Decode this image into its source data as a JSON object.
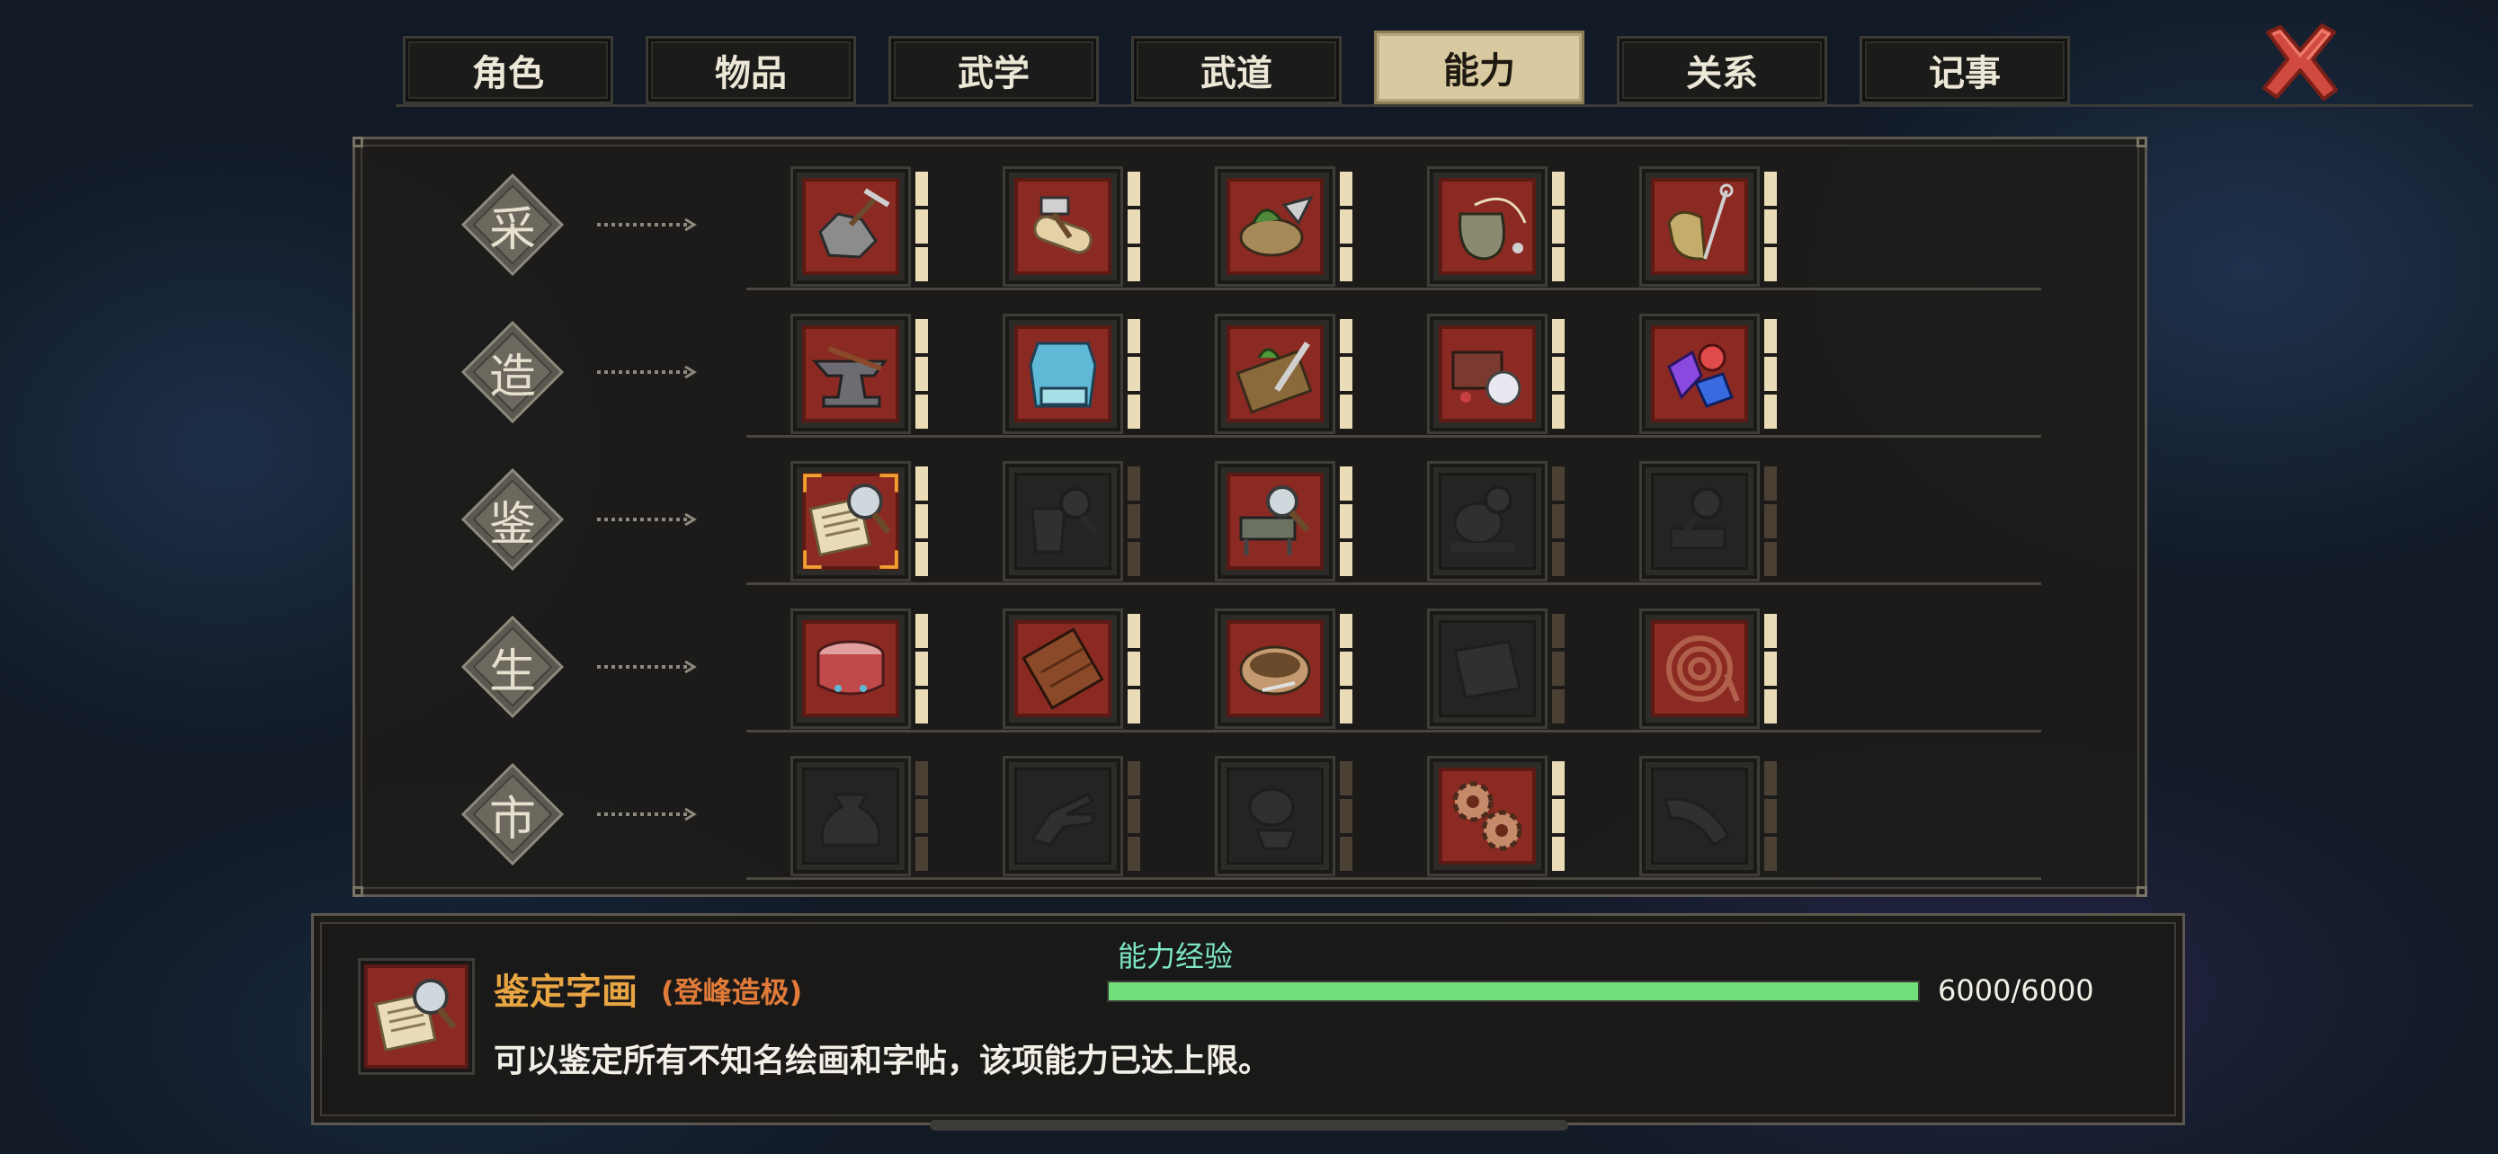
{
  "tabs": [
    {
      "label": "角色",
      "active": false
    },
    {
      "label": "物品",
      "active": false
    },
    {
      "label": "武学",
      "active": false
    },
    {
      "label": "武道",
      "active": false
    },
    {
      "label": "能力",
      "active": true
    },
    {
      "label": "关系",
      "active": false
    },
    {
      "label": "记事",
      "active": false
    }
  ],
  "close_icon": "close-x-icon",
  "categories": [
    {
      "label": "采",
      "skills": [
        {
          "icon": "ore-pick-icon",
          "unlocked": true,
          "level_bars": 3
        },
        {
          "icon": "axe-log-icon",
          "unlocked": true,
          "level_bars": 3
        },
        {
          "icon": "herb-basket-icon",
          "unlocked": true,
          "level_bars": 3
        },
        {
          "icon": "fishing-pot-icon",
          "unlocked": true,
          "level_bars": 3
        },
        {
          "icon": "net-rod-icon",
          "unlocked": true,
          "level_bars": 3
        }
      ]
    },
    {
      "label": "造",
      "skills": [
        {
          "icon": "anvil-icon",
          "unlocked": true,
          "level_bars": 3
        },
        {
          "icon": "armor-cloth-icon",
          "unlocked": true,
          "level_bars": 3
        },
        {
          "icon": "herb-knife-board-icon",
          "unlocked": true,
          "level_bars": 3
        },
        {
          "icon": "jewelry-box-icon",
          "unlocked": true,
          "level_bars": 3
        },
        {
          "icon": "gem-stones-icon",
          "unlocked": true,
          "level_bars": 3
        }
      ]
    },
    {
      "label": "鉴",
      "skills": [
        {
          "icon": "scroll-magnifier-icon",
          "unlocked": true,
          "level_bars": 3,
          "selected": true
        },
        {
          "icon": "pot-magnifier-icon",
          "unlocked": false,
          "level_bars": 3
        },
        {
          "icon": "furniture-magnifier-icon",
          "unlocked": true,
          "level_bars": 3
        },
        {
          "icon": "ornament-magnifier-icon",
          "unlocked": false,
          "level_bars": 3
        },
        {
          "icon": "ink-magnifier-icon",
          "unlocked": false,
          "level_bars": 3
        }
      ]
    },
    {
      "label": "生",
      "skills": [
        {
          "icon": "drum-icon",
          "unlocked": true,
          "level_bars": 3
        },
        {
          "icon": "chocolate-board-icon",
          "unlocked": true,
          "level_bars": 3
        },
        {
          "icon": "bowl-icon",
          "unlocked": true,
          "level_bars": 3
        },
        {
          "icon": "cloth-icon",
          "unlocked": false,
          "level_bars": 3
        },
        {
          "icon": "coiled-rope-icon",
          "unlocked": true,
          "level_bars": 3
        }
      ]
    },
    {
      "label": "市",
      "skills": [
        {
          "icon": "money-bag-icon",
          "unlocked": false,
          "level_bars": 3
        },
        {
          "icon": "hand-icon",
          "unlocked": false,
          "level_bars": 3
        },
        {
          "icon": "mortar-icon",
          "unlocked": false,
          "level_bars": 3
        },
        {
          "icon": "gears-icon",
          "unlocked": true,
          "level_bars": 3
        },
        {
          "icon": "horn-icon",
          "unlocked": false,
          "level_bars": 3
        }
      ]
    }
  ],
  "detail": {
    "icon": "scroll-magnifier-icon",
    "name": "鉴定字画",
    "level": "(登峰造极)",
    "exp_label": "能力经验",
    "exp_value": "6000/6000",
    "exp_fraction": 1.0,
    "description": "可以鉴定所有不知名绘画和字帖，该项能力已达上限。"
  },
  "colors": {
    "accent_gold": "#e7a544",
    "exp_bar": "#72e07a",
    "slot_unlocked": "#8a2a22",
    "tab_active": "#d9c9a0"
  }
}
